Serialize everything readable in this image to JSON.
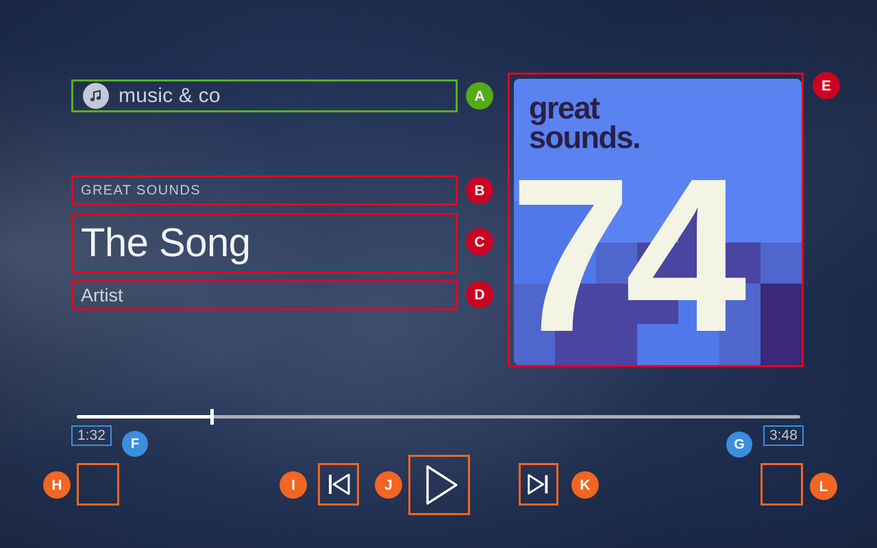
{
  "app": {
    "name": "music & co",
    "icon": "music-note-icon"
  },
  "now_playing": {
    "album_label": "GREAT SOUNDS",
    "track_title": "The Song",
    "artist": "Artist"
  },
  "album_art": {
    "wordmark_line1": "great",
    "wordmark_line2": "sounds.",
    "number": "74",
    "colors": {
      "base": "#5a82f0",
      "tile_mid": "#4a5fc8",
      "tile_deep": "#4a45a0",
      "tile_dark": "#3a2878",
      "number": "#f4f4e4",
      "wordmark": "#2a1f45"
    },
    "tiles": [
      "#5a82f0",
      "#5a82f0",
      "#5a82f0",
      "#5a82f0",
      "#5a82f0",
      "#5a82f0",
      "#5a82f0",
      "#5a82f0",
      "#5a82f0",
      "#5a82f0",
      "#5a82f0",
      "#5a82f0",
      "#5a82f0",
      "#5a82f0",
      "#5a82f0",
      "#5a82f0",
      "#5a82f0",
      "#5a82f0",
      "#5a82f0",
      "#5a82f0",
      "#5a82f0",
      "#5078ea",
      "#5078ea",
      "#5a82f0",
      "#5a82f0",
      "#4a45a0",
      "#5a82f0",
      "#5a82f0",
      "#5078ea",
      "#5078ea",
      "#4f66cc",
      "#4a45a0",
      "#4a45a0",
      "#4a45a0",
      "#4f66cc",
      "#4f66cc",
      "#4a45a0",
      "#4a45a0",
      "#4a45a0",
      "#5078ea",
      "#4f66cc",
      "#3a2878",
      "#4f66cc",
      "#4a45a0",
      "#4a45a0",
      "#5078ea",
      "#5078ea",
      "#4f66cc",
      "#3a2878"
    ]
  },
  "player": {
    "time_elapsed": "1:32",
    "time_total": "3:48",
    "progress_percent": 18.7
  },
  "controls": {
    "left_extra_label": "",
    "previous_label": "previous-track",
    "play_label": "play",
    "next_label": "next-track",
    "right_extra_label": ""
  },
  "annotations": [
    {
      "id": "A",
      "color": "#56a917",
      "target": "app-name-field"
    },
    {
      "id": "B",
      "color": "#cc0222",
      "target": "album-label-field"
    },
    {
      "id": "C",
      "color": "#cc0222",
      "target": "track-title-field"
    },
    {
      "id": "D",
      "color": "#cc0222",
      "target": "artist-field"
    },
    {
      "id": "E",
      "color": "#cc0222",
      "target": "album-art"
    },
    {
      "id": "F",
      "color": "#3c8ede",
      "target": "time-elapsed"
    },
    {
      "id": "G",
      "color": "#3c8ede",
      "target": "time-total"
    },
    {
      "id": "H",
      "color": "#f26522",
      "target": "left-extra-button"
    },
    {
      "id": "I",
      "color": "#f26522",
      "target": "previous-button"
    },
    {
      "id": "J",
      "color": "#f26522",
      "target": "play-button"
    },
    {
      "id": "K",
      "color": "#f26522",
      "target": "next-button"
    },
    {
      "id": "L",
      "color": "#f26522",
      "target": "right-extra-button"
    }
  ]
}
